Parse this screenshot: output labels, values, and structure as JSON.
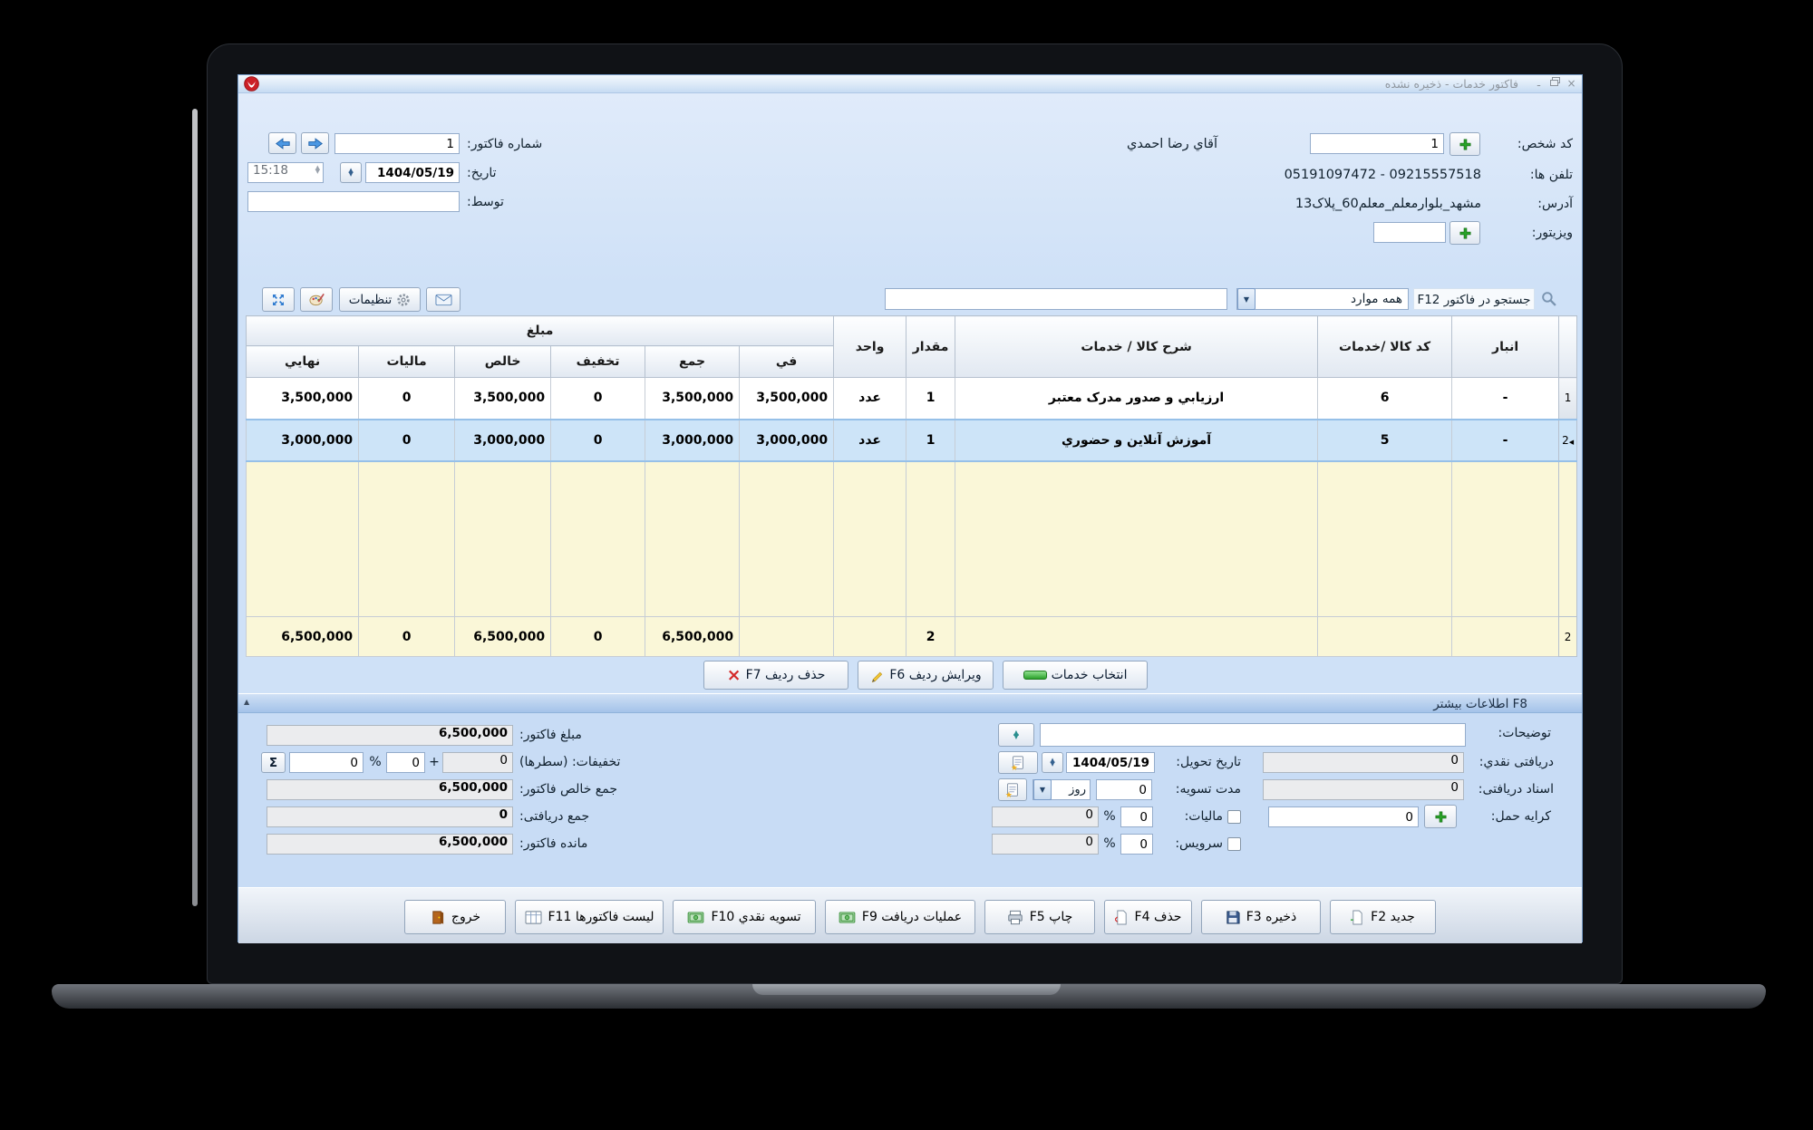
{
  "colors": {
    "accent_green": "#28a428",
    "danger_red": "#d42a2a",
    "selection_blue": "#cde4f8",
    "grid_empty_yellow": "#faf7d8",
    "window_blue": "#cfe1f7"
  },
  "symbols": {
    "percent": "%",
    "plus": "+",
    "sigma": "Σ"
  },
  "window": {
    "title": "فاکتور خدمات - ذخیره نشده"
  },
  "header": {
    "person_label": "کد شخص:",
    "person_code": "1",
    "person_name": "آقاي رضا احمدي",
    "phones_label": "تلفن ها:",
    "phones_value": "05191097472 - 09215557518",
    "address_label": "آدرس:",
    "address_value": "مشهد_بلوارمعلم_معلم60_پلاک13",
    "visitor_label": "ویزیتور:",
    "visitor_value": "",
    "invoice_no_label": "شماره فاکتور:",
    "invoice_no": "1",
    "date_label": "تاریخ:",
    "date_value": "1404/05/19",
    "time_value": "15:18",
    "by_label": "توسط:",
    "by_value": ""
  },
  "toolbar": {
    "settings_label": "تنظیمات",
    "search_label": "جستجو در فاکتور F12",
    "search_filter": "همه موارد",
    "search_value": ""
  },
  "grid": {
    "amount_group": "مبلغ",
    "columns": {
      "final": "نهايي",
      "tax": "مالیات",
      "net": "خالص",
      "discount": "تخفیف",
      "sum": "جمع",
      "price": "في",
      "unit": "واحد",
      "qty": "مقدار",
      "desc": "شرح کالا / خدمات",
      "code": "کد کالا /خدمات",
      "store": "انبار"
    },
    "rows": [
      {
        "num": "1",
        "store": "-",
        "code": "6",
        "desc": "ارزیابي و صدور مدرک معتبر",
        "qty": "1",
        "unit": "عدد",
        "price": "3,500,000",
        "sum": "3,500,000",
        "discount": "0",
        "net": "3,500,000",
        "tax": "0",
        "final": "3,500,000"
      },
      {
        "num": "2",
        "store": "-",
        "code": "5",
        "desc": "آموزش آنلاین و حضوري",
        "qty": "1",
        "unit": "عدد",
        "price": "3,000,000",
        "sum": "3,000,000",
        "discount": "0",
        "net": "3,000,000",
        "tax": "0",
        "final": "3,000,000"
      }
    ],
    "totals": {
      "count": "2",
      "qty": "2",
      "sum": "6,500,000",
      "discount": "0",
      "net": "6,500,000",
      "tax": "0",
      "final": "6,500,000"
    }
  },
  "row_actions": {
    "delete": "حذف ردیف F7",
    "edit": "ویرایش ردیف F6",
    "select": "انتخاب خدمات"
  },
  "more_info_label": "F8 اطلاعات بیشتر",
  "summary": {
    "invoice_amount_label": "مبلغ فاکتور:",
    "invoice_amount": "6,500,000",
    "discounts_label": "تخفیفات: (سطرها)",
    "discount_rows": "0",
    "discount_amount": "0",
    "discount_percent": "0",
    "net_label": "جمع خالص فاکتور:",
    "net_value": "6,500,000",
    "received_label": "جمع دریافتی:",
    "received_value": "0",
    "balance_label": "مانده فاکتور:",
    "balance_value": "6,500,000"
  },
  "details": {
    "notes_label": "توضیحات:",
    "notes_value": "",
    "cash_label": "دریافتی نقدي:",
    "cash_value": "0",
    "docs_label": "اسناد دریافتی:",
    "docs_value": "0",
    "freight_label": "کرایه حمل:",
    "freight_value": "0",
    "delivery_label": "تاریخ تحویل:",
    "delivery_value": "1404/05/19",
    "settlement_label": "مدت تسویه:",
    "settlement_value": "0",
    "settlement_unit": "روز",
    "tax_label": "مالیات:",
    "tax_percent": "0",
    "tax_amount": "0",
    "service_label": "سرویس:",
    "service_percent": "0",
    "service_amount": "0"
  },
  "actions": {
    "exit": "خروج",
    "invoice_list": "لیست فاکتورها F11",
    "cash_settle": "تسویه نقدي F10",
    "receive_ops": "عملیات دریافت F9",
    "print": "چاپ F5",
    "delete": "حذف F4",
    "save": "ذخیره F3",
    "new": "جدید F2"
  }
}
